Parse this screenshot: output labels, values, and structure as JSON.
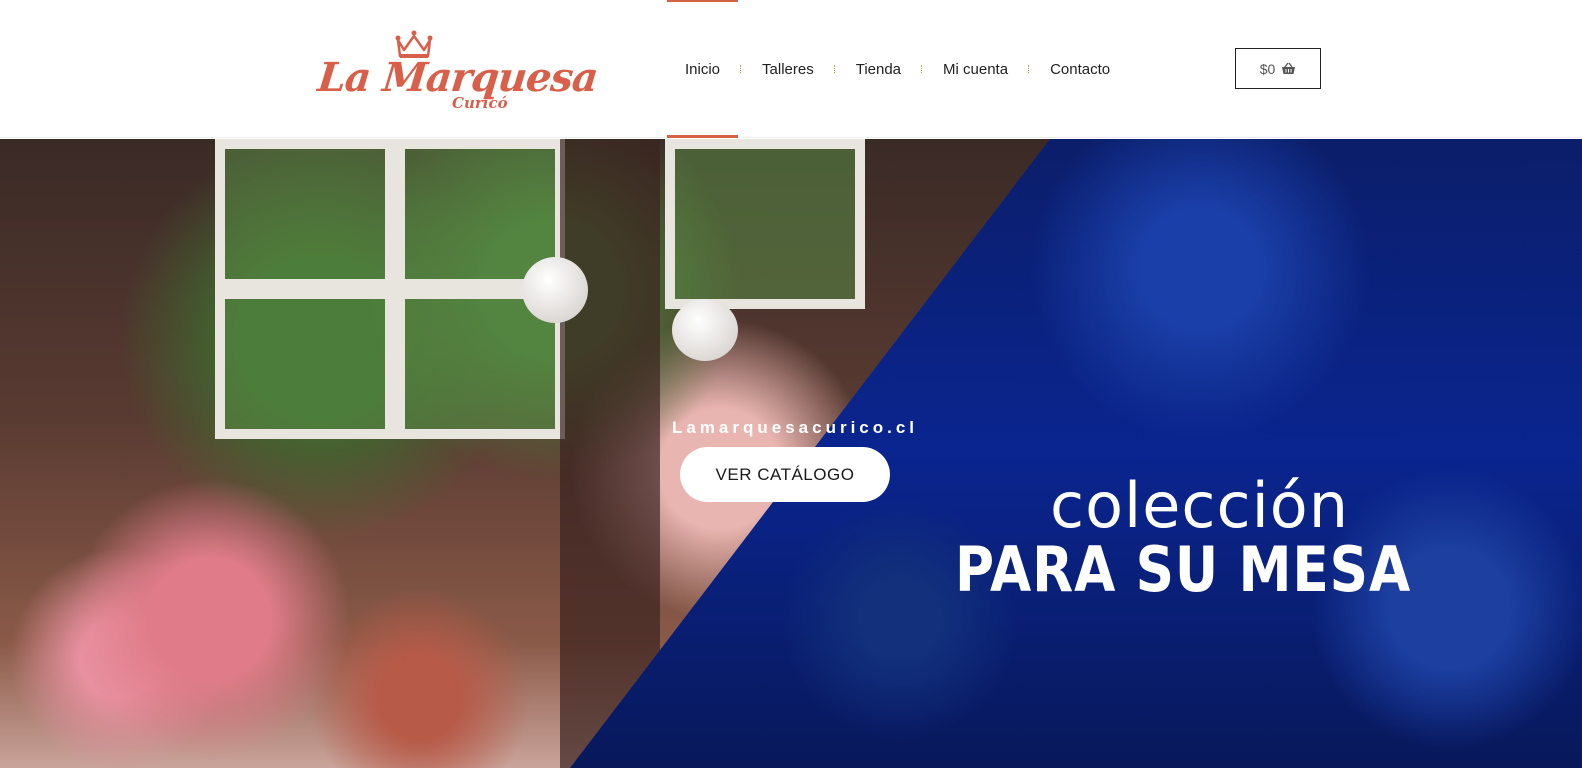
{
  "brand": {
    "name": "La Marquesa",
    "city": "Curicó",
    "color": "#d8604a",
    "icon": "crown-icon"
  },
  "nav": {
    "items": [
      {
        "label": "Inicio",
        "active": true
      },
      {
        "label": "Talleres",
        "active": false
      },
      {
        "label": "Tienda",
        "active": false
      },
      {
        "label": "Mi cuenta",
        "active": false
      },
      {
        "label": "Contacto",
        "active": false
      }
    ]
  },
  "cart": {
    "total": "$0",
    "icon": "basket-icon"
  },
  "hero": {
    "site": "Lamarquesacurico.cl",
    "cta_label": "VER CATÁLOGO",
    "headline_1": "colección",
    "headline_2": "PARA SU MESA"
  }
}
